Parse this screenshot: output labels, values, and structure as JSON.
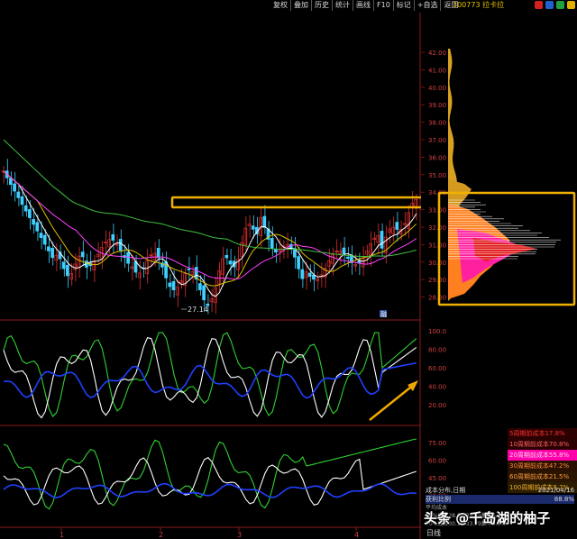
{
  "toolbar": {
    "items": [
      "复权",
      "叠加",
      "历史",
      "统计",
      "画线",
      "F10",
      "标记",
      "+自选",
      "返回"
    ]
  },
  "stock": {
    "code_name": "300773 拉卡拉"
  },
  "main_chart": {
    "price_axis": [
      "42.00",
      "41.00",
      "40.00",
      "39.00",
      "38.00",
      "37.00",
      "36.00",
      "35.00",
      "34.00",
      "33.00",
      "32.00",
      "31.00",
      "30.00",
      "29.00",
      "28.00"
    ],
    "low_label": "27.14",
    "marker": "融"
  },
  "osc1_axis": [
    "100.0",
    "80.00",
    "60.00",
    "40.00",
    "20.00"
  ],
  "osc2_axis": [
    "75.00",
    "60.00",
    "45.00",
    "30.00"
  ],
  "x_ticks": [
    "1",
    "2",
    "3",
    "4"
  ],
  "cost_legend": [
    {
      "label": "5周期前成本17.8%",
      "bg": "#2a0000",
      "color": "#ff3030"
    },
    {
      "label": "10周期前成本70.8%",
      "bg": "#2a0000",
      "color": "#ff6060"
    },
    {
      "label": "20周期前成本55.8%",
      "bg": "#ff00aa",
      "color": "#ffd0ee"
    },
    {
      "label": "30周期前成本47.2%",
      "bg": "#2a1000",
      "color": "#ff8a3a"
    },
    {
      "label": "60周期前成本21.5%",
      "bg": "#2a1500",
      "color": "#ff9a40"
    },
    {
      "label": "100周期前成本8.7%",
      "bg": "#2a1c00",
      "color": "#f0b030"
    }
  ],
  "dist_info": {
    "title": "成本分布,日期",
    "date": "2021/04/16",
    "ratio_label": "获利比例",
    "ratio_value": "88.8%",
    "avg_cost_label": "平均成本",
    "line_90": "90%成本28.60-35.09集中6.4%",
    "line_70": "70%成本30.19-33.79集中5.6%"
  },
  "watermark": "头条 @千岛湖的柚子",
  "bottom_tab": "日线",
  "colors": {
    "up": "#e03030",
    "down": "#40d0ff",
    "ma_white": "#ffffff",
    "ma_yellow": "#e0c000",
    "ma_magenta": "#ff40ff",
    "ma_green": "#40c040",
    "line_blue": "#2040ff",
    "highlight": "#f0b000"
  }
}
